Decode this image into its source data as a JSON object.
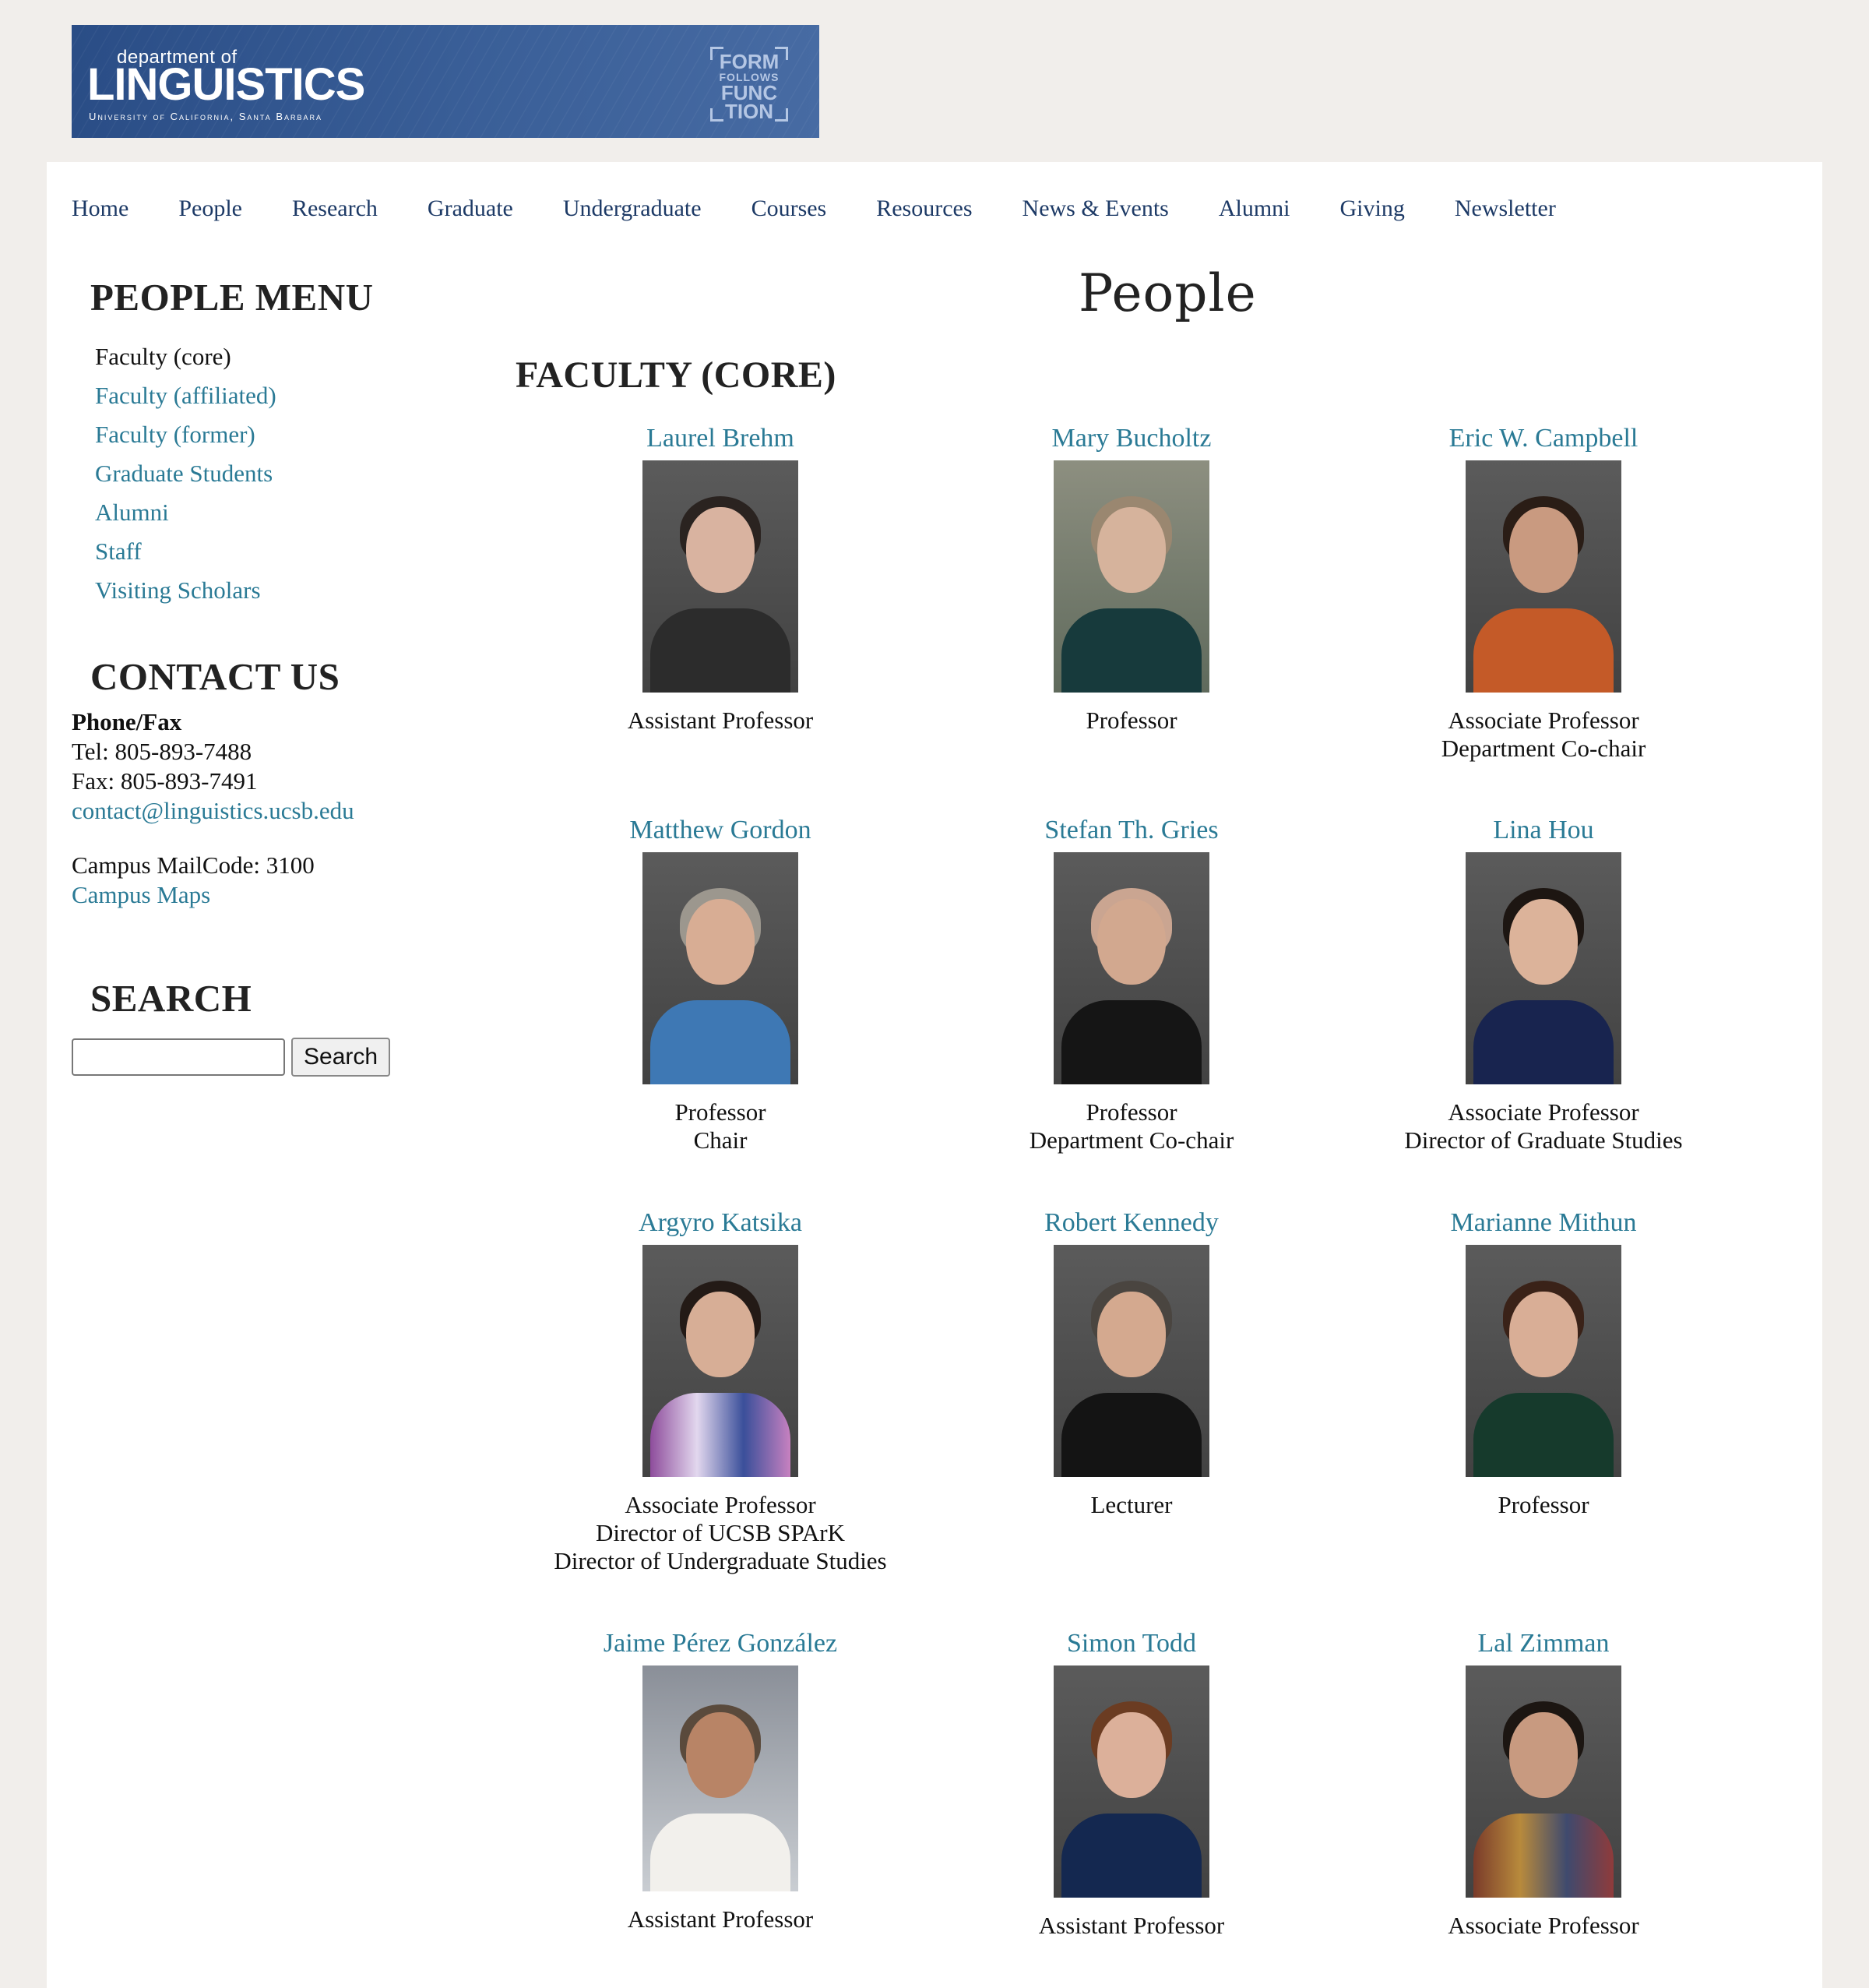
{
  "banner": {
    "dept_small": "department of",
    "dept_big": "LINGUISTICS",
    "university": "University of California, Santa Barbara",
    "tag_lines": [
      "FORM",
      "FOLLOWS",
      "FUNC",
      "TION"
    ]
  },
  "nav": [
    "Home",
    "People",
    "Research",
    "Graduate",
    "Undergraduate",
    "Courses",
    "Resources",
    "News & Events",
    "Alumni",
    "Giving",
    "Newsletter"
  ],
  "sidebar": {
    "people_menu_title": "PEOPLE MENU",
    "people_menu": [
      "Faculty (core)",
      "Faculty (affiliated)",
      "Faculty (former)",
      "Graduate Students",
      "Alumni",
      "Staff",
      "Visiting Scholars"
    ],
    "contact_title": "CONTACT US",
    "phone_label": "Phone/Fax",
    "tel": "Tel: 805-893-7488",
    "fax": "Fax: 805-893-7491",
    "email": "contact@linguistics.ucsb.edu",
    "mailcode": "Campus MailCode: 3100",
    "maps": "Campus Maps",
    "search_title": "SEARCH",
    "search_button": "Search",
    "search_value": ""
  },
  "main": {
    "page_title": "People",
    "section_title": "FACULTY (CORE)",
    "faculty": [
      {
        "name": "Laurel Brehm",
        "roles": [
          "Assistant Professor"
        ]
      },
      {
        "name": "Mary Bucholtz",
        "roles": [
          "Professor"
        ]
      },
      {
        "name": "Eric W. Campbell",
        "roles": [
          "Associate Professor",
          "Department Co-chair"
        ]
      },
      {
        "name": "Matthew Gordon",
        "roles": [
          "Professor",
          "Chair"
        ]
      },
      {
        "name": "Stefan Th. Gries",
        "roles": [
          "Professor",
          "Department Co-chair"
        ]
      },
      {
        "name": "Lina Hou",
        "roles": [
          "Associate Professor",
          "Director of Graduate Studies"
        ]
      },
      {
        "name": "Argyro Katsika",
        "roles": [
          "Associate Professor",
          "Director of UCSB SPArK",
          "Director of Undergraduate Studies"
        ]
      },
      {
        "name": "Robert Kennedy",
        "roles": [
          "Lecturer"
        ]
      },
      {
        "name": "Marianne Mithun",
        "roles": [
          "Professor"
        ]
      },
      {
        "name": "Jaime Pérez González",
        "roles": [
          "Assistant Professor"
        ]
      },
      {
        "name": "Simon Todd",
        "roles": [
          "Assistant Professor"
        ]
      },
      {
        "name": "Lal Zimman",
        "roles": [
          "Associate Professor"
        ]
      }
    ]
  },
  "colors": {
    "link": "#2a7a95",
    "nav_link": "#1d3a66",
    "page_bg": "#f1eeeb",
    "banner_blue": "#2a4d86"
  }
}
